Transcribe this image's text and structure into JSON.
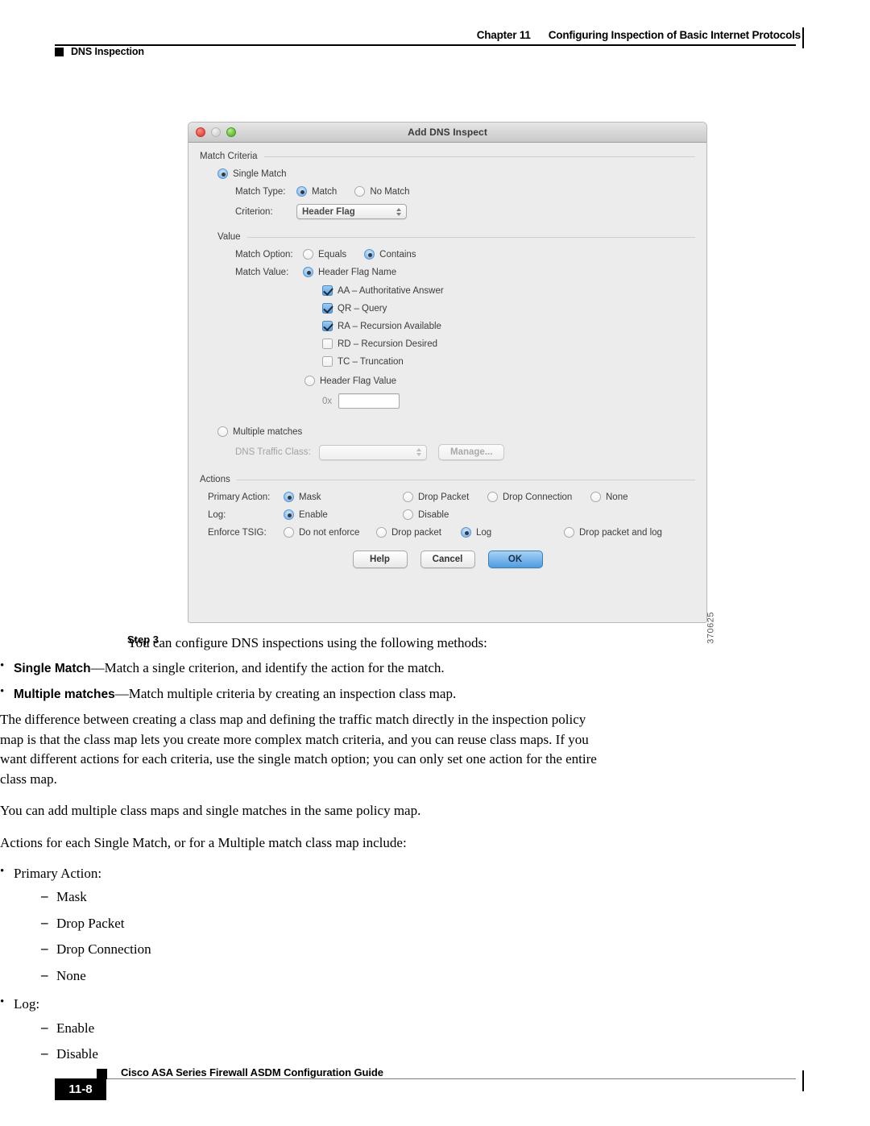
{
  "header": {
    "chapter": "Chapter 11",
    "chapter_title": "Configuring Inspection of Basic Internet Protocols",
    "section": "DNS Inspection"
  },
  "dialog": {
    "title": "Add DNS Inspect",
    "figure_id": "370625",
    "match_criteria": {
      "group_label": "Match Criteria",
      "single_match_label": "Single Match",
      "match_type_label": "Match Type:",
      "match_option_match": "Match",
      "match_option_no_match": "No Match",
      "criterion_label": "Criterion:",
      "criterion_value": "Header Flag"
    },
    "value": {
      "group_label": "Value",
      "match_option_label": "Match Option:",
      "equals": "Equals",
      "contains": "Contains",
      "match_value_label": "Match Value:",
      "header_flag_name": "Header Flag Name",
      "flags": [
        {
          "label": "AA – Authoritative Answer",
          "checked": true
        },
        {
          "label": "QR – Query",
          "checked": true
        },
        {
          "label": "RA – Recursion Available",
          "checked": true
        },
        {
          "label": "RD – Recursion Desired",
          "checked": false
        },
        {
          "label": "TC – Truncation",
          "checked": false
        }
      ],
      "header_flag_value": "Header Flag Value",
      "hex_prefix": "0x",
      "hex_value": ""
    },
    "multiple": {
      "multiple_matches_label": "Multiple matches",
      "dns_traffic_class_label": "DNS Traffic Class:",
      "dns_traffic_class_value": "",
      "manage_label": "Manage..."
    },
    "actions": {
      "group_label": "Actions",
      "primary_action_label": "Primary Action:",
      "primary_options": [
        "Mask",
        "Drop Packet",
        "Drop Connection",
        "None"
      ],
      "log_label": "Log:",
      "log_options": [
        "Enable",
        "Disable"
      ],
      "tsig_label": "Enforce TSIG:",
      "tsig_options": [
        "Do not enforce",
        "Drop packet",
        "Log",
        "Drop packet and log"
      ]
    },
    "buttons": {
      "help": "Help",
      "cancel": "Cancel",
      "ok": "OK"
    }
  },
  "content": {
    "step_label": "Step 3",
    "step_text": "You can configure DNS inspections using the following methods:",
    "methods": [
      {
        "term": "Single Match",
        "desc": "—Match a single criterion, and identify the action for the match."
      },
      {
        "term": "Multiple matches",
        "desc": "—Match multiple criteria by creating an inspection class map."
      }
    ],
    "para1": "The difference between creating a class map and defining the traffic match directly in the inspection policy map is that the class map lets you create more complex match criteria, and you can reuse class maps. If you want different actions for each criteria, use the single match option; you can only set one action for the entire class map.",
    "para2": "You can add multiple class maps and single matches in the same policy map.",
    "para3": "Actions for each Single Match, or for a Multiple match class map include:",
    "action_groups": [
      {
        "label": "Primary Action:",
        "items": [
          "Mask",
          "Drop Packet",
          "Drop Connection",
          "None"
        ]
      },
      {
        "label": "Log:",
        "items": [
          "Enable",
          "Disable"
        ]
      }
    ]
  },
  "footer": {
    "guide_title": "Cisco ASA Series Firewall ASDM Configuration Guide",
    "page_number": "11-8"
  }
}
